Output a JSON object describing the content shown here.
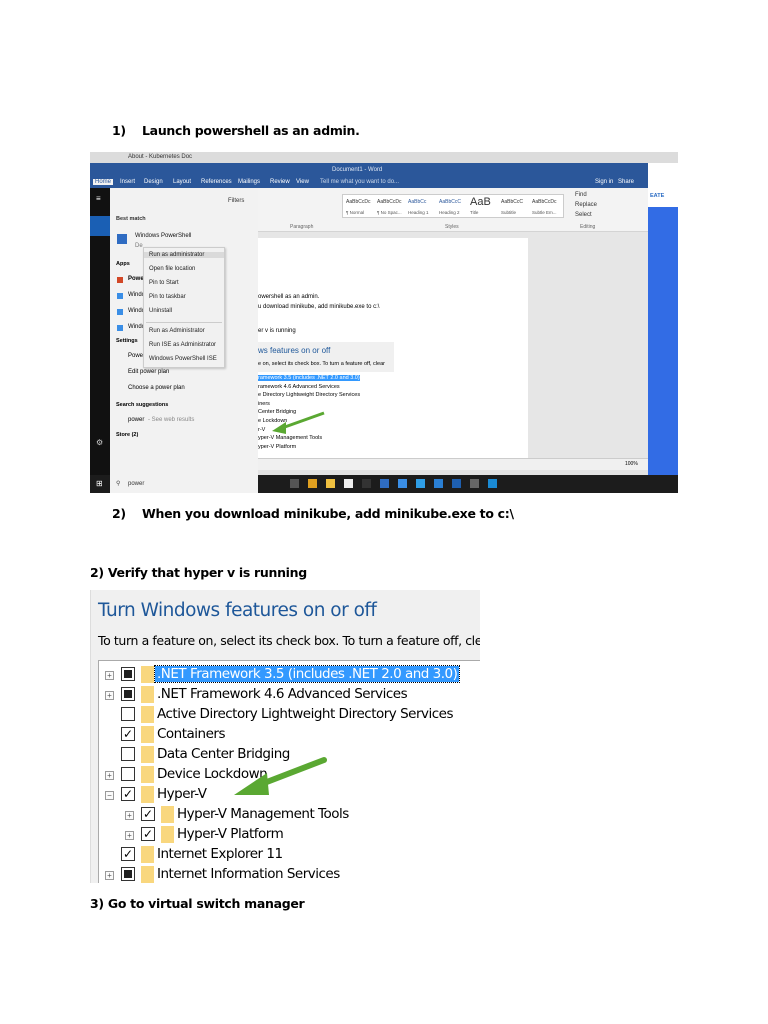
{
  "steps": {
    "step1": "1)    Launch powershell as an admin.",
    "step2": "2)    When you download minikube, add minikube.exe to c:\\",
    "step2b": "2) Verify that hyper v is running",
    "step3": "3) Go to virtual switch manager"
  },
  "screenshot1": {
    "browser_tab": "About - Kubernetes Doc",
    "word_title": "Document1 - Word",
    "tabs": [
      "Home",
      "Insert",
      "Design",
      "Layout",
      "References",
      "Mailings",
      "Review",
      "View"
    ],
    "tell_me": "Tell me what you want to do...",
    "sign_in": "Sign in",
    "share": "Share",
    "styles": [
      "AaBbCcDc",
      "AaBbCcDc",
      "AaBbCc",
      "AaBbCcC",
      "AaB",
      "AaBbCcC",
      "AaBbCcDc"
    ],
    "style_names": [
      "¶ Normal",
      "¶ No Spac...",
      "Heading 1",
      "Heading 2",
      "Title",
      "Subtitle",
      "Subtle Em..."
    ],
    "editing": [
      "Find",
      "Replace",
      "Select"
    ],
    "group_labels": {
      "paragraph": "Paragraph",
      "styles": "Styles",
      "editing": "Editing"
    },
    "browser_create": "EATE",
    "start": {
      "filters": "Filters",
      "best_match": "Best match",
      "best_app": "Windows PowerShell",
      "best_sub": "De",
      "apps_header": "Apps",
      "apps": [
        "Powe",
        "Windo",
        "Windo",
        "Windo"
      ],
      "settings_header": "Settings",
      "settings": [
        "Powe",
        "Edit power plan",
        "Choose a power plan"
      ],
      "suggestions_header": "Search suggestions",
      "suggestion": "power",
      "suggestion_hint": "- See web results",
      "store": "Store (2)",
      "search_value": "power"
    },
    "context_menu": [
      "Run as administrator",
      "Open file location",
      "Pin to Start",
      "Pin to taskbar",
      "Uninstall",
      "Run as Administrator",
      "Run ISE as Administrator",
      "Windows PowerShell ISE"
    ],
    "doc_lines": [
      "owershell as an admin.",
      "u download minikube, add minikube.exe to c:\\",
      "er v is running"
    ],
    "inner_features_title": "ws features on or off",
    "inner_features_desc": "e on, select its check box. To turn a feature off, clear",
    "inner_features": [
      "ramework 3.5 (includes .NET 2.0 and 3.0)",
      "ramework 4.6 Advanced Services",
      "e Directory Lightweight Directory Services",
      "iners",
      "Center Bridging",
      "e Lockdown",
      "r-V",
      "yper-V Management Tools",
      "yper-V Platform"
    ],
    "zoom": "100%"
  },
  "screenshot2": {
    "title": "Turn Windows features on or off",
    "description": "To turn a feature on, select its check box. To turn a feature off, clear",
    "features": [
      {
        "label": ".NET Framework 3.5 (includes .NET 2.0 and 3.0)",
        "state": "partial",
        "expander": "+",
        "level": 0,
        "selected": true
      },
      {
        "label": ".NET Framework 4.6 Advanced Services",
        "state": "partial",
        "expander": "+",
        "level": 0
      },
      {
        "label": "Active Directory Lightweight Directory Services",
        "state": "unchecked",
        "expander": "",
        "level": 0
      },
      {
        "label": "Containers",
        "state": "checked",
        "expander": "",
        "level": 0
      },
      {
        "label": "Data Center Bridging",
        "state": "unchecked",
        "expander": "",
        "level": 0
      },
      {
        "label": "Device Lockdown",
        "state": "unchecked",
        "expander": "+",
        "level": 0
      },
      {
        "label": "Hyper-V",
        "state": "checked",
        "expander": "−",
        "level": 0
      },
      {
        "label": "Hyper-V Management Tools",
        "state": "checked",
        "expander": "+",
        "level": 1
      },
      {
        "label": "Hyper-V Platform",
        "state": "checked",
        "expander": "+",
        "level": 1
      },
      {
        "label": "Internet Explorer 11",
        "state": "checked",
        "expander": "",
        "level": 0
      },
      {
        "label": "Internet Information Services",
        "state": "partial",
        "expander": "+",
        "level": 0
      }
    ]
  },
  "colors": {
    "word_blue": "#2b579a",
    "arrow_green": "#5aa832",
    "selection": "#3399ff",
    "title_blue": "#1e5799"
  }
}
